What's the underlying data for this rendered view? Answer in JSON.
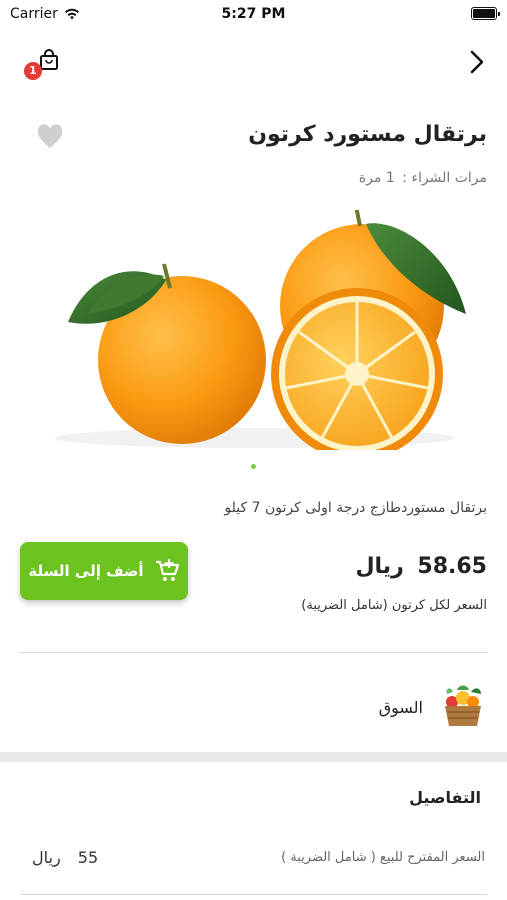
{
  "status_bar": {
    "carrier": "Carrier",
    "time": "5:27 PM"
  },
  "nav": {
    "cart_badge_count": "1",
    "cart_icon": "shopping-bag-icon",
    "back_icon": "chevron-right-icon"
  },
  "product": {
    "title": "برتقال مستورد كرتون",
    "purchases_label": "مرات الشراء :",
    "purchases_value": "1 مرة",
    "description": "برتقال مستوردطازج درجة اولى كرتون 7 كيلو",
    "price_value": "58.65",
    "price_currency": "ريال",
    "price_note": "السعر لكل كرتون (شامل الضريبة)",
    "image_count": 1
  },
  "actions": {
    "add_to_cart_label": "أضف إلى السلة",
    "favorite_icon": "heart-icon"
  },
  "market": {
    "label": "السوق",
    "icon": "vegetable-basket-icon"
  },
  "details": {
    "title": "التفاصيل",
    "suggested_price_label": "السعر المقترح للبيع ( شامل الضريبة )",
    "suggested_price_value": "55",
    "suggested_price_currency": "ريال"
  },
  "colors": {
    "accent_green": "#6cc21e",
    "badge_red": "#e53935",
    "favorite_gray": "#cfcfcf"
  }
}
